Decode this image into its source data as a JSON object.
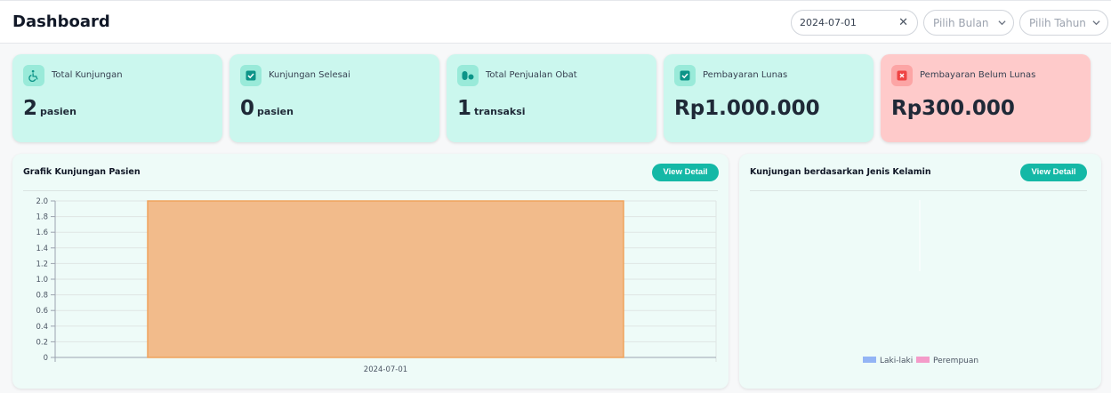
{
  "header": {
    "title": "Dashboard",
    "date_value": "2024-07-01",
    "clear_icon": "close-icon",
    "month_placeholder": "Pilih Bulan",
    "year_placeholder": "Pilih Tahun"
  },
  "cards": [
    {
      "label": "Total Kunjungan",
      "value": "2",
      "unit": "pasien",
      "icon": "wheelchair-icon"
    },
    {
      "label": "Kunjungan Selesai",
      "value": "0",
      "unit": "pasien",
      "icon": "check-icon"
    },
    {
      "label": "Total Penjualan Obat",
      "value": "1",
      "unit": "transaksi",
      "icon": "pills-icon"
    },
    {
      "label": "Pembayaran Lunas",
      "value": "Rp1.000.000",
      "unit": "",
      "icon": "check-icon"
    },
    {
      "label": "Pembayaran Belum Lunas",
      "value": "Rp300.000",
      "unit": "",
      "icon": "x-icon"
    }
  ],
  "colors": {
    "accent": "#14b8a6",
    "card_green": "#cbf7ee",
    "card_red": "#fecaca",
    "bar_fill": "#f2bb8b",
    "bar_border": "#f0a35c",
    "legend_male": "#93b4f5",
    "legend_female": "#f49bc9"
  },
  "visits_panel": {
    "title": "Grafik Kunjungan Pasien",
    "button": "View Detail"
  },
  "gender_panel": {
    "title": "Kunjungan berdasarkan Jenis Kelamin",
    "button": "View Detail"
  },
  "chart_data": [
    {
      "type": "bar",
      "categories": [
        "2024-07-01"
      ],
      "values": [
        2
      ],
      "ylim": [
        0,
        2
      ],
      "yticks": [
        "2.0",
        "1.8",
        "1.6",
        "1.4",
        "1.2",
        "1.0",
        "0.8",
        "0.6",
        "0.4",
        "0.2",
        "0"
      ],
      "grid": true
    },
    {
      "type": "pie",
      "labels": [
        "Laki-laki",
        "Perempuan"
      ],
      "values": [],
      "legend": "bottom"
    }
  ]
}
